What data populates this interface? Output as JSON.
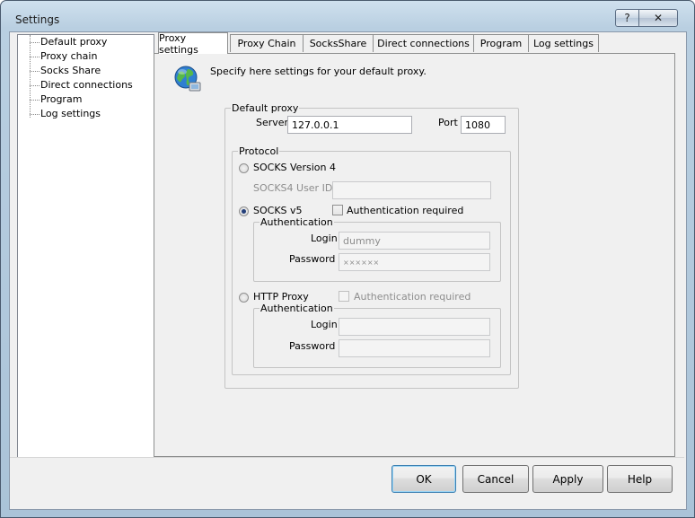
{
  "window": {
    "title": "Settings",
    "help_glyph": "?",
    "close_glyph": "✕"
  },
  "tree": {
    "items": [
      "Default proxy",
      "Proxy chain",
      "Socks Share",
      "Direct connections",
      "Program",
      "Log settings"
    ]
  },
  "tabs": [
    "Proxy settings",
    "Proxy Chain",
    "SocksShare",
    "Direct connections",
    "Program",
    "Log settings"
  ],
  "header_text": "Specify here settings for your default proxy.",
  "default_proxy": {
    "legend": "Default proxy",
    "server_label": "Server",
    "server_value": "127.0.0.1",
    "port_label": "Port",
    "port_value": "1080"
  },
  "protocol": {
    "legend": "Protocol",
    "socks4_label": "SOCKS Version 4",
    "socks4_userid_label": "SOCKS4 User ID",
    "socks4_userid_value": "",
    "socks5_label": "SOCKS v5",
    "socks5_auth_label": "Authentication required",
    "socks5_auth_legend": "Authentication",
    "socks5_login_label": "Login",
    "socks5_login_value": "dummy",
    "socks5_password_label": "Password",
    "socks5_password_value": "××××××",
    "http_label": "HTTP Proxy",
    "http_auth_label": "Authentication required",
    "http_auth_legend": "Authentication",
    "http_login_label": "Login",
    "http_login_value": "",
    "http_password_label": "Password",
    "http_password_value": ""
  },
  "buttons": {
    "ok": "OK",
    "cancel": "Cancel",
    "apply": "Apply",
    "help": "Help"
  },
  "icons": {
    "globe": "globe-network-icon"
  }
}
